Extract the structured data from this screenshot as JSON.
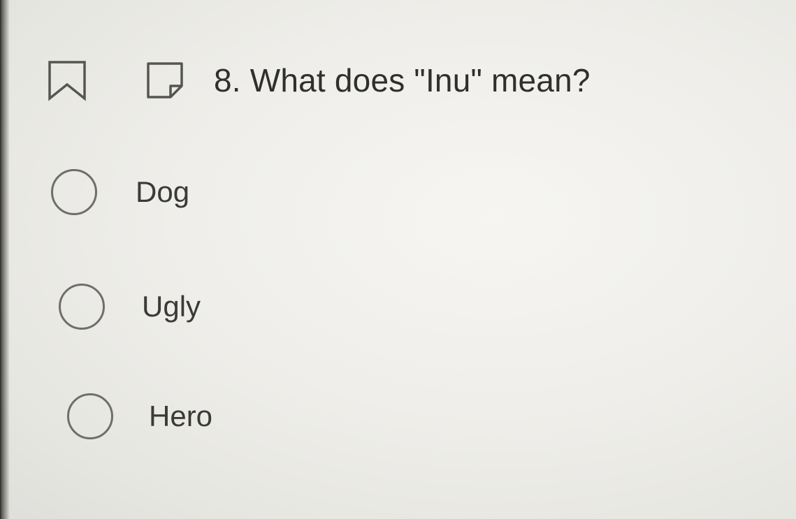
{
  "question": {
    "text": "8. What does \"Inu\" mean?",
    "bookmark_icon": "bookmark-icon",
    "note_icon": "note-icon"
  },
  "options": [
    {
      "label": "Dog"
    },
    {
      "label": "Ugly"
    },
    {
      "label": "Hero"
    }
  ]
}
